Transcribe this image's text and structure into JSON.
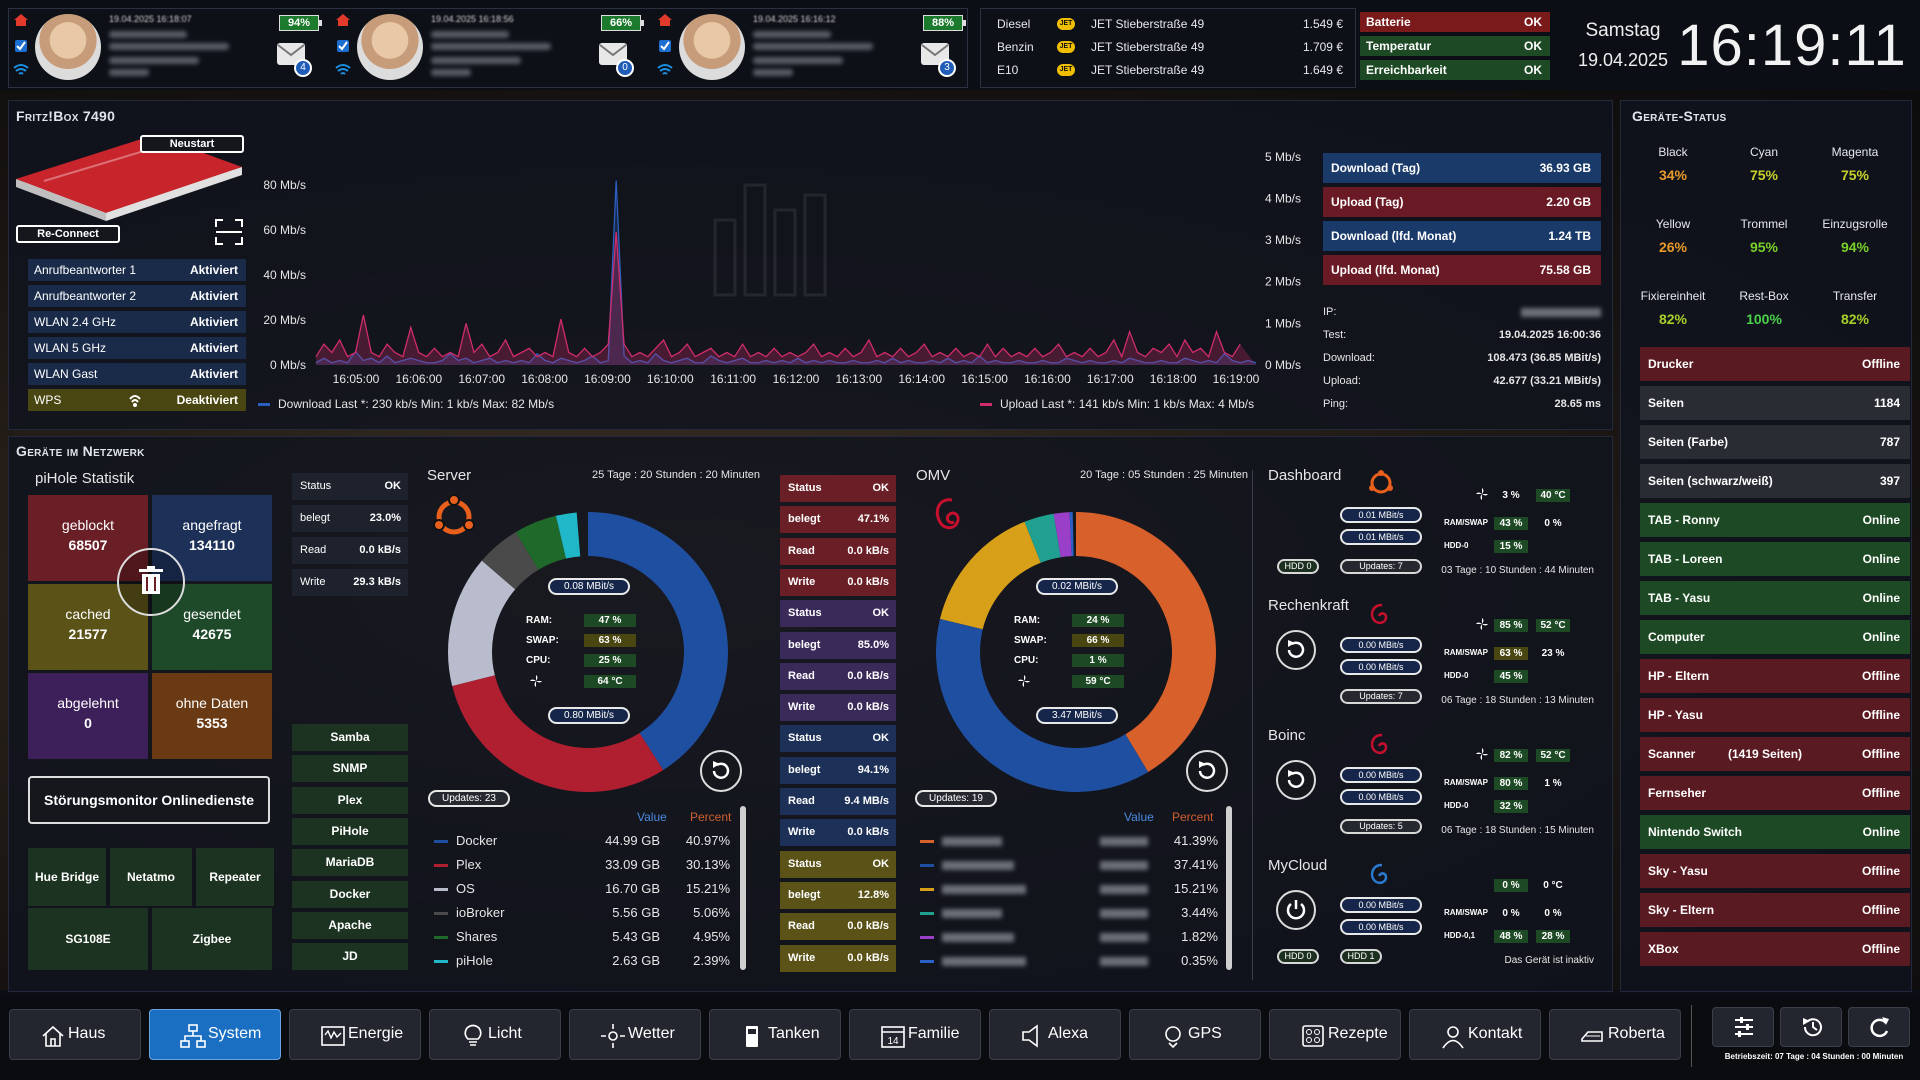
{
  "persons": [
    {
      "battery": "94%",
      "badge": "4",
      "date": "19.04.2025 16:18:07"
    },
    {
      "battery": "66%",
      "badge": "0",
      "date": "19.04.2025 16:18:56"
    },
    {
      "battery": "88%",
      "badge": "3",
      "date": "19.04.2025 16:16:12"
    }
  ],
  "fuel": [
    {
      "type": "Diesel",
      "station": "JET Stieberstraße 49",
      "price": "1.549 €"
    },
    {
      "type": "Benzin",
      "station": "JET Stieberstraße 49",
      "price": "1.709 €"
    },
    {
      "type": "E10",
      "station": "JET Stieberstraße 49",
      "price": "1.649 €"
    }
  ],
  "status": [
    {
      "label": "Batterie",
      "value": "OK",
      "color": "#7a1a1a"
    },
    {
      "label": "Temperatur",
      "value": "OK",
      "color": "#1d4a24"
    },
    {
      "label": "Erreichbarkeit",
      "value": "OK",
      "color": "#1d4a24"
    }
  ],
  "clock": {
    "weekday": "Samstag",
    "date": "19.04.2025",
    "time": "16:19:11"
  },
  "fritz": {
    "title": "Fritz!Box 7490",
    "restart": "Neustart",
    "reconnect": "Re-Connect",
    "rows": [
      {
        "label": "Anrufbeantworter 1",
        "value": "Aktiviert"
      },
      {
        "label": "Anrufbeantworter 2",
        "value": "Aktiviert"
      },
      {
        "label": "WLAN 2.4 GHz",
        "value": "Aktiviert"
      },
      {
        "label": "WLAN 5 GHz",
        "value": "Aktiviert"
      },
      {
        "label": "WLAN Gast",
        "value": "Aktiviert"
      },
      {
        "label": "WPS",
        "value": "Deaktiviert"
      }
    ],
    "traffic": [
      {
        "label": "Download (Tag)",
        "value": "36.93 GB",
        "color": "#1a3a6a"
      },
      {
        "label": "Upload (Tag)",
        "value": "2.20 GB",
        "color": "#6a1a24"
      },
      {
        "label": "Download (lfd. Monat)",
        "value": "1.24 TB",
        "color": "#1a3a6a"
      },
      {
        "label": "Upload (lfd. Monat)",
        "value": "75.58 GB",
        "color": "#6a1a24"
      }
    ],
    "info": [
      {
        "label": "IP:",
        "value": ""
      },
      {
        "label": "Test:",
        "value": "19.04.2025 16:00:36"
      },
      {
        "label": "Download:",
        "value": "108.473 (36.85 MBit/s)"
      },
      {
        "label": "Upload:",
        "value": "42.677 (33.21 MBit/s)"
      },
      {
        "label": "Ping:",
        "value": "28.65 ms"
      }
    ]
  },
  "chart_data": {
    "type": "line",
    "x": [
      "16:05:00",
      "16:06:00",
      "16:07:00",
      "16:08:00",
      "16:09:00",
      "16:10:00",
      "16:11:00",
      "16:12:00",
      "16:13:00",
      "16:14:00",
      "16:15:00",
      "16:16:00",
      "16:17:00",
      "16:18:00",
      "16:19:00"
    ],
    "yleft_ticks": [
      "0 Mb/s",
      "20 Mb/s",
      "40 Mb/s",
      "60 Mb/s",
      "80 Mb/s"
    ],
    "yright_ticks": [
      "0 Mb/s",
      "1 Mb/s",
      "2 Mb/s",
      "3 Mb/s",
      "4 Mb/s",
      "5 Mb/s"
    ],
    "ylim_left": [
      0,
      80
    ],
    "ylim_right": [
      0,
      5
    ],
    "series": [
      {
        "name": "Download",
        "color": "#2a5fc0",
        "values": [
          1,
          3,
          1,
          2,
          1,
          6,
          2,
          3,
          1,
          4,
          1,
          2,
          3,
          2,
          1,
          1,
          2,
          5,
          2,
          3,
          1,
          2,
          3,
          1,
          2,
          1,
          2,
          1,
          5,
          2,
          1,
          3,
          2,
          1,
          2,
          4,
          1,
          2,
          82,
          4,
          1,
          2,
          1,
          5,
          2,
          1,
          2,
          3,
          1,
          1,
          4,
          2,
          1,
          2,
          3,
          1,
          1,
          2,
          1,
          2,
          1,
          3,
          1,
          2,
          1,
          2,
          1,
          1,
          2,
          1,
          1,
          2,
          1,
          3,
          1,
          2,
          1,
          1,
          2,
          1,
          3,
          1,
          2,
          1,
          4,
          1,
          2,
          1,
          1,
          2,
          1,
          1,
          2,
          1,
          1,
          3,
          2,
          1,
          2,
          1,
          1,
          2,
          1,
          3,
          2,
          1,
          1,
          2,
          1,
          1,
          3,
          2,
          1,
          2,
          1,
          5,
          2,
          1,
          2,
          1
        ]
      },
      {
        "name": "Upload",
        "color": "#d02c6c",
        "values": [
          0.2,
          0.5,
          0.3,
          0.6,
          0.2,
          0.3,
          1.2,
          0.3,
          0.2,
          0.5,
          0.3,
          0.2,
          0.9,
          0.3,
          0.2,
          0.4,
          0.2,
          0.3,
          0.2,
          1.0,
          0.3,
          0.5,
          0.2,
          0.3,
          0.6,
          0.2,
          0.3,
          0.4,
          0.2,
          0.3,
          0.2,
          1.1,
          0.3,
          0.2,
          0.4,
          0.2,
          0.3,
          0.5,
          3.2,
          0.5,
          0.2,
          0.3,
          0.2,
          0.4,
          0.6,
          0.2,
          0.3,
          0.5,
          0.2,
          0.3,
          0.4,
          0.2,
          0.3,
          0.2,
          0.5,
          0.2,
          0.3,
          0.2,
          0.4,
          0.2,
          0.3,
          0.2,
          0.3,
          0.5,
          0.2,
          0.3,
          0.2,
          0.4,
          0.2,
          0.3,
          0.6,
          0.2,
          0.3,
          0.2,
          0.4,
          0.2,
          0.3,
          0.5,
          0.2,
          0.3,
          0.2,
          0.4,
          0.2,
          0.3,
          0.2,
          0.5,
          0.2,
          0.4,
          0.2,
          0.3,
          0.2,
          0.4,
          0.2,
          0.3,
          0.5,
          0.2,
          0.3,
          0.2,
          0.4,
          0.2,
          0.3,
          0.6,
          0.2,
          0.8,
          0.3,
          0.2,
          0.4,
          0.3,
          0.5,
          0.2,
          0.6,
          0.3,
          0.4,
          0.2,
          0.8,
          0.3,
          0.2,
          0.5
        ]
      }
    ],
    "legend": {
      "download": "Download  Last *: 230 kb/s  Min: 1 kb/s  Max: 82 Mb/s",
      "upload": "Upload  Last *: 141 kb/s  Min: 1 kb/s  Max: 4 Mb/s"
    }
  },
  "network": {
    "title": "Geräte im Netzwerk",
    "pihole": {
      "title": "piHole Statistik",
      "tiles": [
        {
          "label": "geblockt",
          "value": "68507",
          "color": "#6a1f26"
        },
        {
          "label": "angefragt",
          "value": "134110",
          "color": "#1d3158"
        },
        {
          "label": "cached",
          "value": "21577",
          "color": "#5a5217"
        },
        {
          "label": "gesendet",
          "value": "42675",
          "color": "#1f4a2a"
        },
        {
          "label": "abgelehnt",
          "value": "0",
          "color": "#3d1f5a"
        },
        {
          "label": "ohne Daten",
          "value": "5353",
          "color": "#6a3a14"
        }
      ],
      "monitor": "Störungsmonitor Onlinedienste",
      "buttons": [
        "Hue Bridge",
        "Netatmo",
        "Repeater",
        "SG108E",
        "Zigbee"
      ]
    },
    "services": [
      "Samba",
      "SNMP",
      "Plex",
      "PiHole",
      "MariaDB",
      "Docker",
      "Apache",
      "JD"
    ],
    "server": {
      "title": "Server",
      "uptime": "25 Tage : 20 Stunden : 20 Minuten",
      "stats": [
        {
          "label": "Status",
          "value": "OK"
        },
        {
          "label": "belegt",
          "value": "23.0%"
        },
        {
          "label": "Read",
          "value": "0.0 kB/s"
        },
        {
          "label": "Write",
          "value": "29.3 kB/s"
        }
      ],
      "net_up": "0.08 MBit/s",
      "net_down": "0.80 MBit/s",
      "ram": "47 %",
      "swap": "63 %",
      "cpu": "25 %",
      "temp": "64 °C",
      "updates": "Updates: 23",
      "headers": {
        "value": "Value",
        "percent": "Percent"
      },
      "legend": [
        {
          "name": "Docker",
          "value": "44.99 GB",
          "percent": "40.97%",
          "color": "#1f4fa0"
        },
        {
          "name": "Plex",
          "value": "33.09 GB",
          "percent": "30.13%",
          "color": "#b01f30"
        },
        {
          "name": "OS",
          "value": "16.70 GB",
          "percent": "15.21%",
          "color": "#b8bccc"
        },
        {
          "name": "ioBroker",
          "value": "5.56 GB",
          "percent": "5.06%",
          "color": "#4a4a4a"
        },
        {
          "name": "Shares",
          "value": "5.43 GB",
          "percent": "4.95%",
          "color": "#1f6a2a"
        },
        {
          "name": "piHole",
          "value": "2.63 GB",
          "percent": "2.39%",
          "color": "#20b8c8"
        }
      ]
    },
    "omv": {
      "title": "OMV",
      "uptime": "20 Tage : 05 Stunden : 25 Minuten",
      "stats": [
        {
          "label": "Status",
          "value": "OK",
          "color": "#6a1f26"
        },
        {
          "label": "belegt",
          "value": "47.1%",
          "color": "#6a1f26"
        },
        {
          "label": "Read",
          "value": "0.0 kB/s",
          "color": "#6a1f26"
        },
        {
          "label": "Write",
          "value": "0.0 kB/s",
          "color": "#6a1f26"
        },
        {
          "label": "Status",
          "value": "OK",
          "color": "#3a2a5a"
        },
        {
          "label": "belegt",
          "value": "85.0%",
          "color": "#3a2a5a"
        },
        {
          "label": "Read",
          "value": "0.0 kB/s",
          "color": "#3a2a5a"
        },
        {
          "label": "Write",
          "value": "0.0 kB/s",
          "color": "#3a2a5a"
        },
        {
          "label": "Status",
          "value": "OK",
          "color": "#1d3158"
        },
        {
          "label": "belegt",
          "value": "94.1%",
          "color": "#1d3158"
        },
        {
          "label": "Read",
          "value": "9.4 MB/s",
          "color": "#1d3158"
        },
        {
          "label": "Write",
          "value": "0.0 kB/s",
          "color": "#1d3158"
        },
        {
          "label": "Status",
          "value": "OK",
          "color": "#5a5217"
        },
        {
          "label": "belegt",
          "value": "12.8%",
          "color": "#5a5217"
        },
        {
          "label": "Read",
          "value": "0.0 kB/s",
          "color": "#5a5217"
        },
        {
          "label": "Write",
          "value": "0.0 kB/s",
          "color": "#5a5217"
        }
      ],
      "net_up": "0.02 MBit/s",
      "net_down": "3.47 MBit/s",
      "ram": "24 %",
      "swap": "66 %",
      "cpu": "1 %",
      "temp": "59 °C",
      "updates": "Updates: 19",
      "headers": {
        "value": "Value",
        "percent": "Percent"
      },
      "legend": [
        {
          "percent": "41.39%",
          "color": "#d8602a"
        },
        {
          "percent": "37.41%",
          "color": "#1f4fa0"
        },
        {
          "percent": "15.21%",
          "color": "#d8a018"
        },
        {
          "percent": "3.44%",
          "color": "#20a090"
        },
        {
          "percent": "1.82%",
          "color": "#9a40c8"
        },
        {
          "percent": "0.35%",
          "color": "#2a60c8"
        }
      ]
    },
    "machines": [
      {
        "name": "Dashboard",
        "up": "0.01 MBit/s",
        "down": "0.01 MBit/s",
        "cpu": "3 %",
        "temp": "40 °C",
        "ram": "43 %",
        "swap": "0 %",
        "hddlabel": "HDD-0",
        "hdd": "15 %",
        "updates": "Updates: 7",
        "hdd_pill": "HDD 0",
        "uptime": "03 Tage : 10 Stunden : 44 Minuten"
      },
      {
        "name": "Rechenkraft",
        "up": "0.00 MBit/s",
        "down": "0.00 MBit/s",
        "cpu": "85 %",
        "temp": "52 °C",
        "ram": "63 %",
        "swap": "23 %",
        "hddlabel": "HDD-0",
        "hdd": "45 %",
        "updates": "Updates: 7",
        "uptime": "06 Tage : 18 Stunden : 13 Minuten"
      },
      {
        "name": "Boinc",
        "up": "0.00 MBit/s",
        "down": "0.00 MBit/s",
        "cpu": "82 %",
        "temp": "52 °C",
        "ram": "80 %",
        "swap": "1 %",
        "hddlabel": "HDD-0",
        "hdd": "32 %",
        "updates": "Updates: 5",
        "uptime": "06 Tage : 18 Stunden : 15 Minuten"
      },
      {
        "name": "MyCloud",
        "up": "0.00 MBit/s",
        "down": "0.00 MBit/s",
        "cpu": "0 %",
        "temp": "0 °C",
        "ram": "0 %",
        "swap": "0 %",
        "hddlabel": "HDD-0,1",
        "hdd": "48 %",
        "hdd2": "28 %",
        "hdd_pill": "HDD 0",
        "hdd_pill2": "HDD 1",
        "uptime": "Das Gerät ist inaktiv"
      }
    ],
    "ramswap": "RAM/SWAP",
    "ramk": "RAM:",
    "swapk": "SWAP:",
    "cpuk": "CPU:"
  },
  "printer": {
    "title": "Geräte-Status",
    "inks": [
      {
        "label": "Black",
        "value": "34%",
        "color": "#e89a2a"
      },
      {
        "label": "Cyan",
        "value": "75%",
        "color": "#c8d02a"
      },
      {
        "label": "Magenta",
        "value": "75%",
        "color": "#c8d02a"
      },
      {
        "label": "Yellow",
        "value": "26%",
        "color": "#e89a2a"
      },
      {
        "label": "Trommel",
        "value": "95%",
        "color": "#7ad02a"
      },
      {
        "label": "Einzugsrolle",
        "value": "94%",
        "color": "#7ad02a"
      },
      {
        "label": "Fixiereinheit",
        "value": "82%",
        "color": "#a8d02a"
      },
      {
        "label": "Rest-Box",
        "value": "100%",
        "color": "#4ad04a"
      },
      {
        "label": "Transfer",
        "value": "82%",
        "color": "#a8d02a"
      }
    ],
    "devices": [
      {
        "label": "Drucker",
        "value": "Offline",
        "color": "#5a1a22"
      },
      {
        "label": "Seiten",
        "value": "1184",
        "color": "#2a2c34"
      },
      {
        "label": "Seiten (Farbe)",
        "value": "787",
        "color": "#2a2c34"
      },
      {
        "label": "Seiten (schwarz/weiß)",
        "value": "397",
        "color": "#2a2c34"
      },
      {
        "label": "TAB - Ronny",
        "value": "Online",
        "color": "#1d4a24"
      },
      {
        "label": "TAB - Loreen",
        "value": "Online",
        "color": "#1d4a24"
      },
      {
        "label": "TAB - Yasu",
        "value": "Online",
        "color": "#1d4a24"
      },
      {
        "label": "Computer",
        "value": "Online",
        "color": "#1d4a24"
      },
      {
        "label": "HP - Eltern",
        "value": "Offline",
        "color": "#5a1a22"
      },
      {
        "label": "HP - Yasu",
        "value": "Offline",
        "color": "#5a1a22"
      },
      {
        "label": "Scanner",
        "extra": "(1419 Seiten)",
        "value": "Offline",
        "color": "#5a1a22"
      },
      {
        "label": "Fernseher",
        "value": "Offline",
        "color": "#5a1a22"
      },
      {
        "label": "Nintendo Switch",
        "value": "Online",
        "color": "#1d4a24"
      },
      {
        "label": "Sky - Yasu",
        "value": "Offline",
        "color": "#5a1a22"
      },
      {
        "label": "Sky - Eltern",
        "value": "Offline",
        "color": "#5a1a22"
      },
      {
        "label": "XBox",
        "value": "Offline",
        "color": "#5a1a22"
      }
    ]
  },
  "nav": [
    {
      "label": "Haus",
      "icon": "house-icon"
    },
    {
      "label": "System",
      "icon": "network-icon",
      "active": true
    },
    {
      "label": "Energie",
      "icon": "meter-icon"
    },
    {
      "label": "Licht",
      "icon": "bulb-icon"
    },
    {
      "label": "Wetter",
      "icon": "sun-icon"
    },
    {
      "label": "Tanken",
      "icon": "fuel-icon"
    },
    {
      "label": "Familie",
      "icon": "calendar-icon",
      "day": "14"
    },
    {
      "label": "Alexa",
      "icon": "speaker-icon"
    },
    {
      "label": "GPS",
      "icon": "gps-icon"
    },
    {
      "label": "Rezepte",
      "icon": "cooker-icon"
    },
    {
      "label": "Kontakt",
      "icon": "contact-icon"
    },
    {
      "label": "Roberta",
      "icon": "robot-icon"
    }
  ],
  "footer": {
    "runtime": "Betriebszeit: 07 Tage : 04 Stunden : 00 Minuten"
  }
}
